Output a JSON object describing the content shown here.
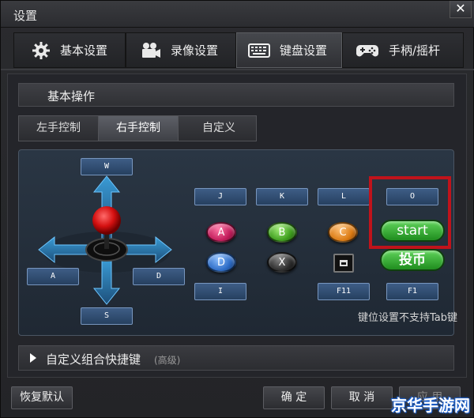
{
  "window": {
    "title": "设置"
  },
  "tabs": [
    {
      "label": "基本设置",
      "icon": "gear-icon"
    },
    {
      "label": "录像设置",
      "icon": "camera-icon"
    },
    {
      "label": "键盘设置",
      "icon": "keyboard-icon",
      "active": true
    },
    {
      "label": "手柄/摇杆",
      "icon": "gamepad-icon"
    }
  ],
  "section": {
    "title": "基本操作"
  },
  "subtabs": [
    {
      "label": "左手控制"
    },
    {
      "label": "右手控制",
      "active": true
    },
    {
      "label": "自定义"
    }
  ],
  "joystick": {
    "up": "W",
    "left": "A",
    "down": "S",
    "right": "D"
  },
  "keys_row1": [
    "J",
    "K",
    "L",
    "O"
  ],
  "buttons": {
    "a": "A",
    "b": "B",
    "c": "C",
    "start": "start",
    "d": "D",
    "x": "X",
    "coin": "投币"
  },
  "keys_row3": [
    "I",
    "F11",
    "F1"
  ],
  "note": "键位设置不支持Tab键",
  "advanced": {
    "label": "自定义组合快捷键",
    "tag": "(高级)"
  },
  "footer": {
    "restore": "恢复默认",
    "ok": "确 定",
    "cancel": "取 消",
    "apply": "应 用"
  },
  "watermark": "京华手游网",
  "colors": {
    "highlight": "#c0131b",
    "start_green": "#2aa52a"
  }
}
